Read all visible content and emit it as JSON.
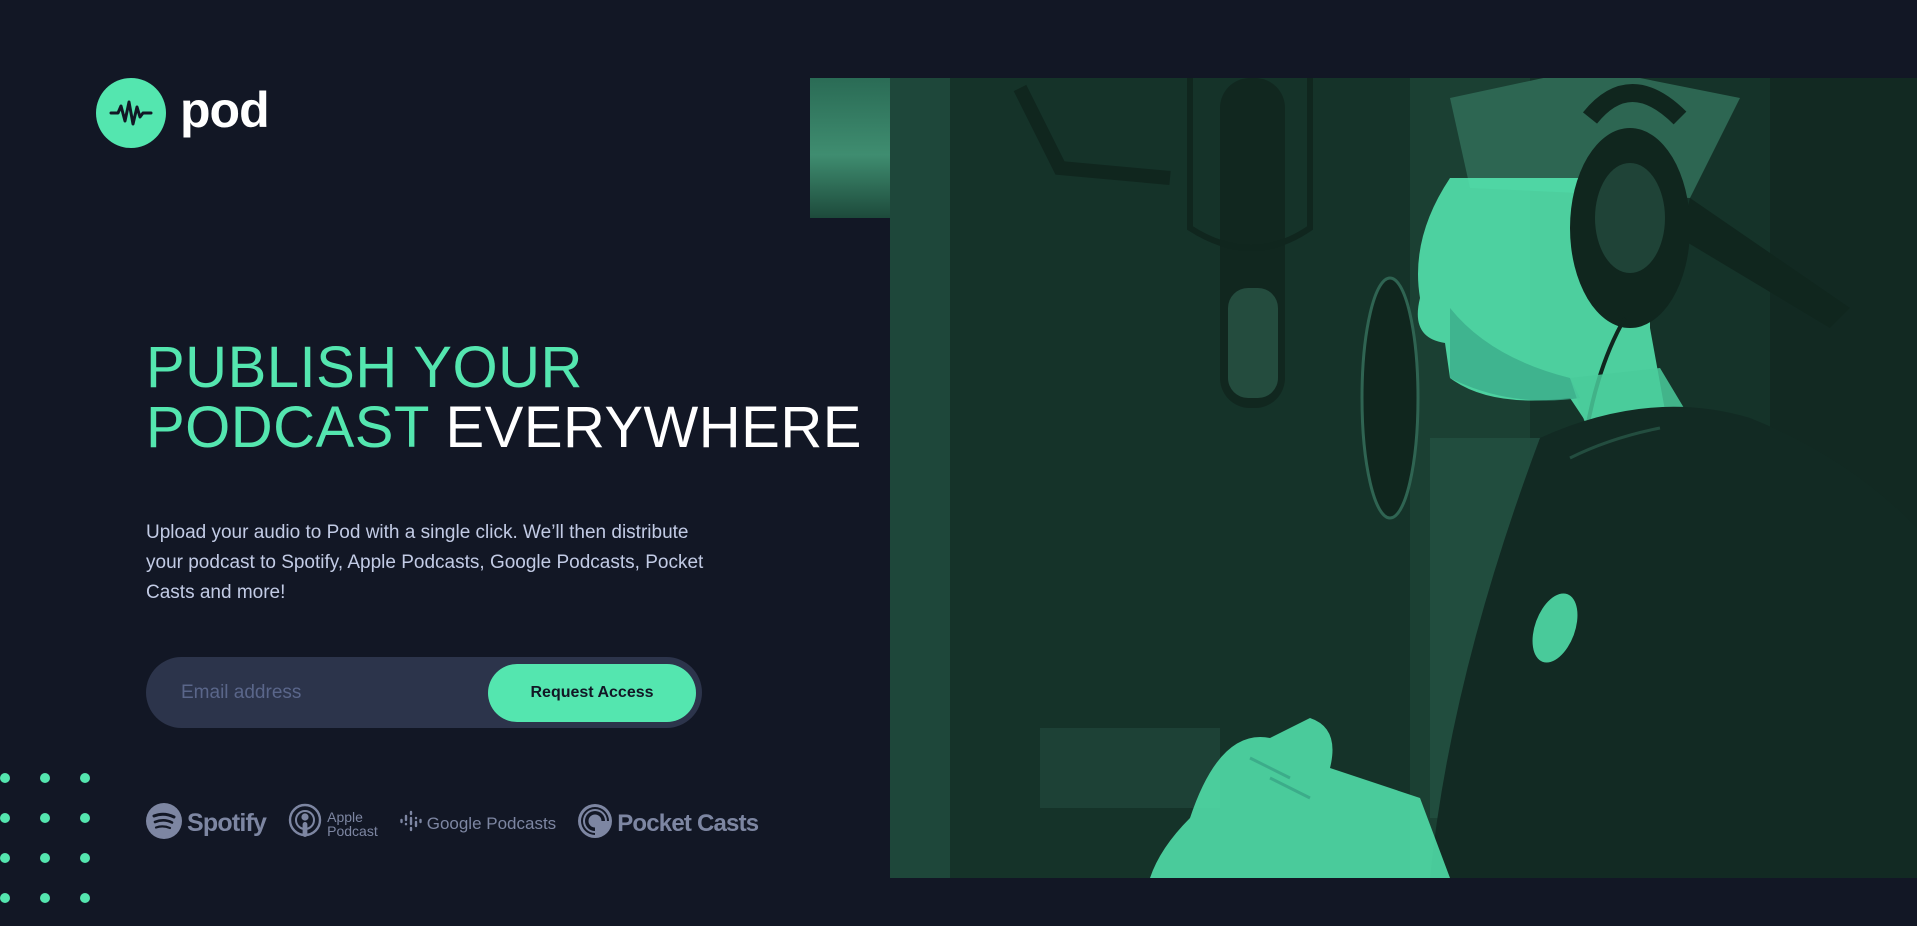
{
  "brand": {
    "name": "pod",
    "accent_color": "#54E6AF",
    "background_color": "#121725"
  },
  "hero": {
    "headline_accent_1": "PUBLISH YOUR",
    "headline_accent_2": "PODCAST",
    "headline_white": "EVERYWHERE",
    "description": "Upload your audio to Pod with a single click. We’ll then distribute your podcast to Spotify, Apple Podcasts, Google Podcasts, Pocket Casts and more!"
  },
  "form": {
    "email_placeholder": "Email address",
    "email_value": "",
    "submit_label": "Request Access"
  },
  "platforms": [
    {
      "name": "Spotify",
      "icon": "spotify-icon"
    },
    {
      "name_line1": "Apple",
      "name_line2": "Podcast",
      "icon": "apple-podcast-icon"
    },
    {
      "name": "Google Podcasts",
      "icon": "google-podcasts-icon"
    },
    {
      "name": "Pocket Casts",
      "icon": "pocket-casts-icon"
    }
  ],
  "image": {
    "subject": "podcaster-at-microphone-photo",
    "tint_color": "#54E6AF"
  }
}
